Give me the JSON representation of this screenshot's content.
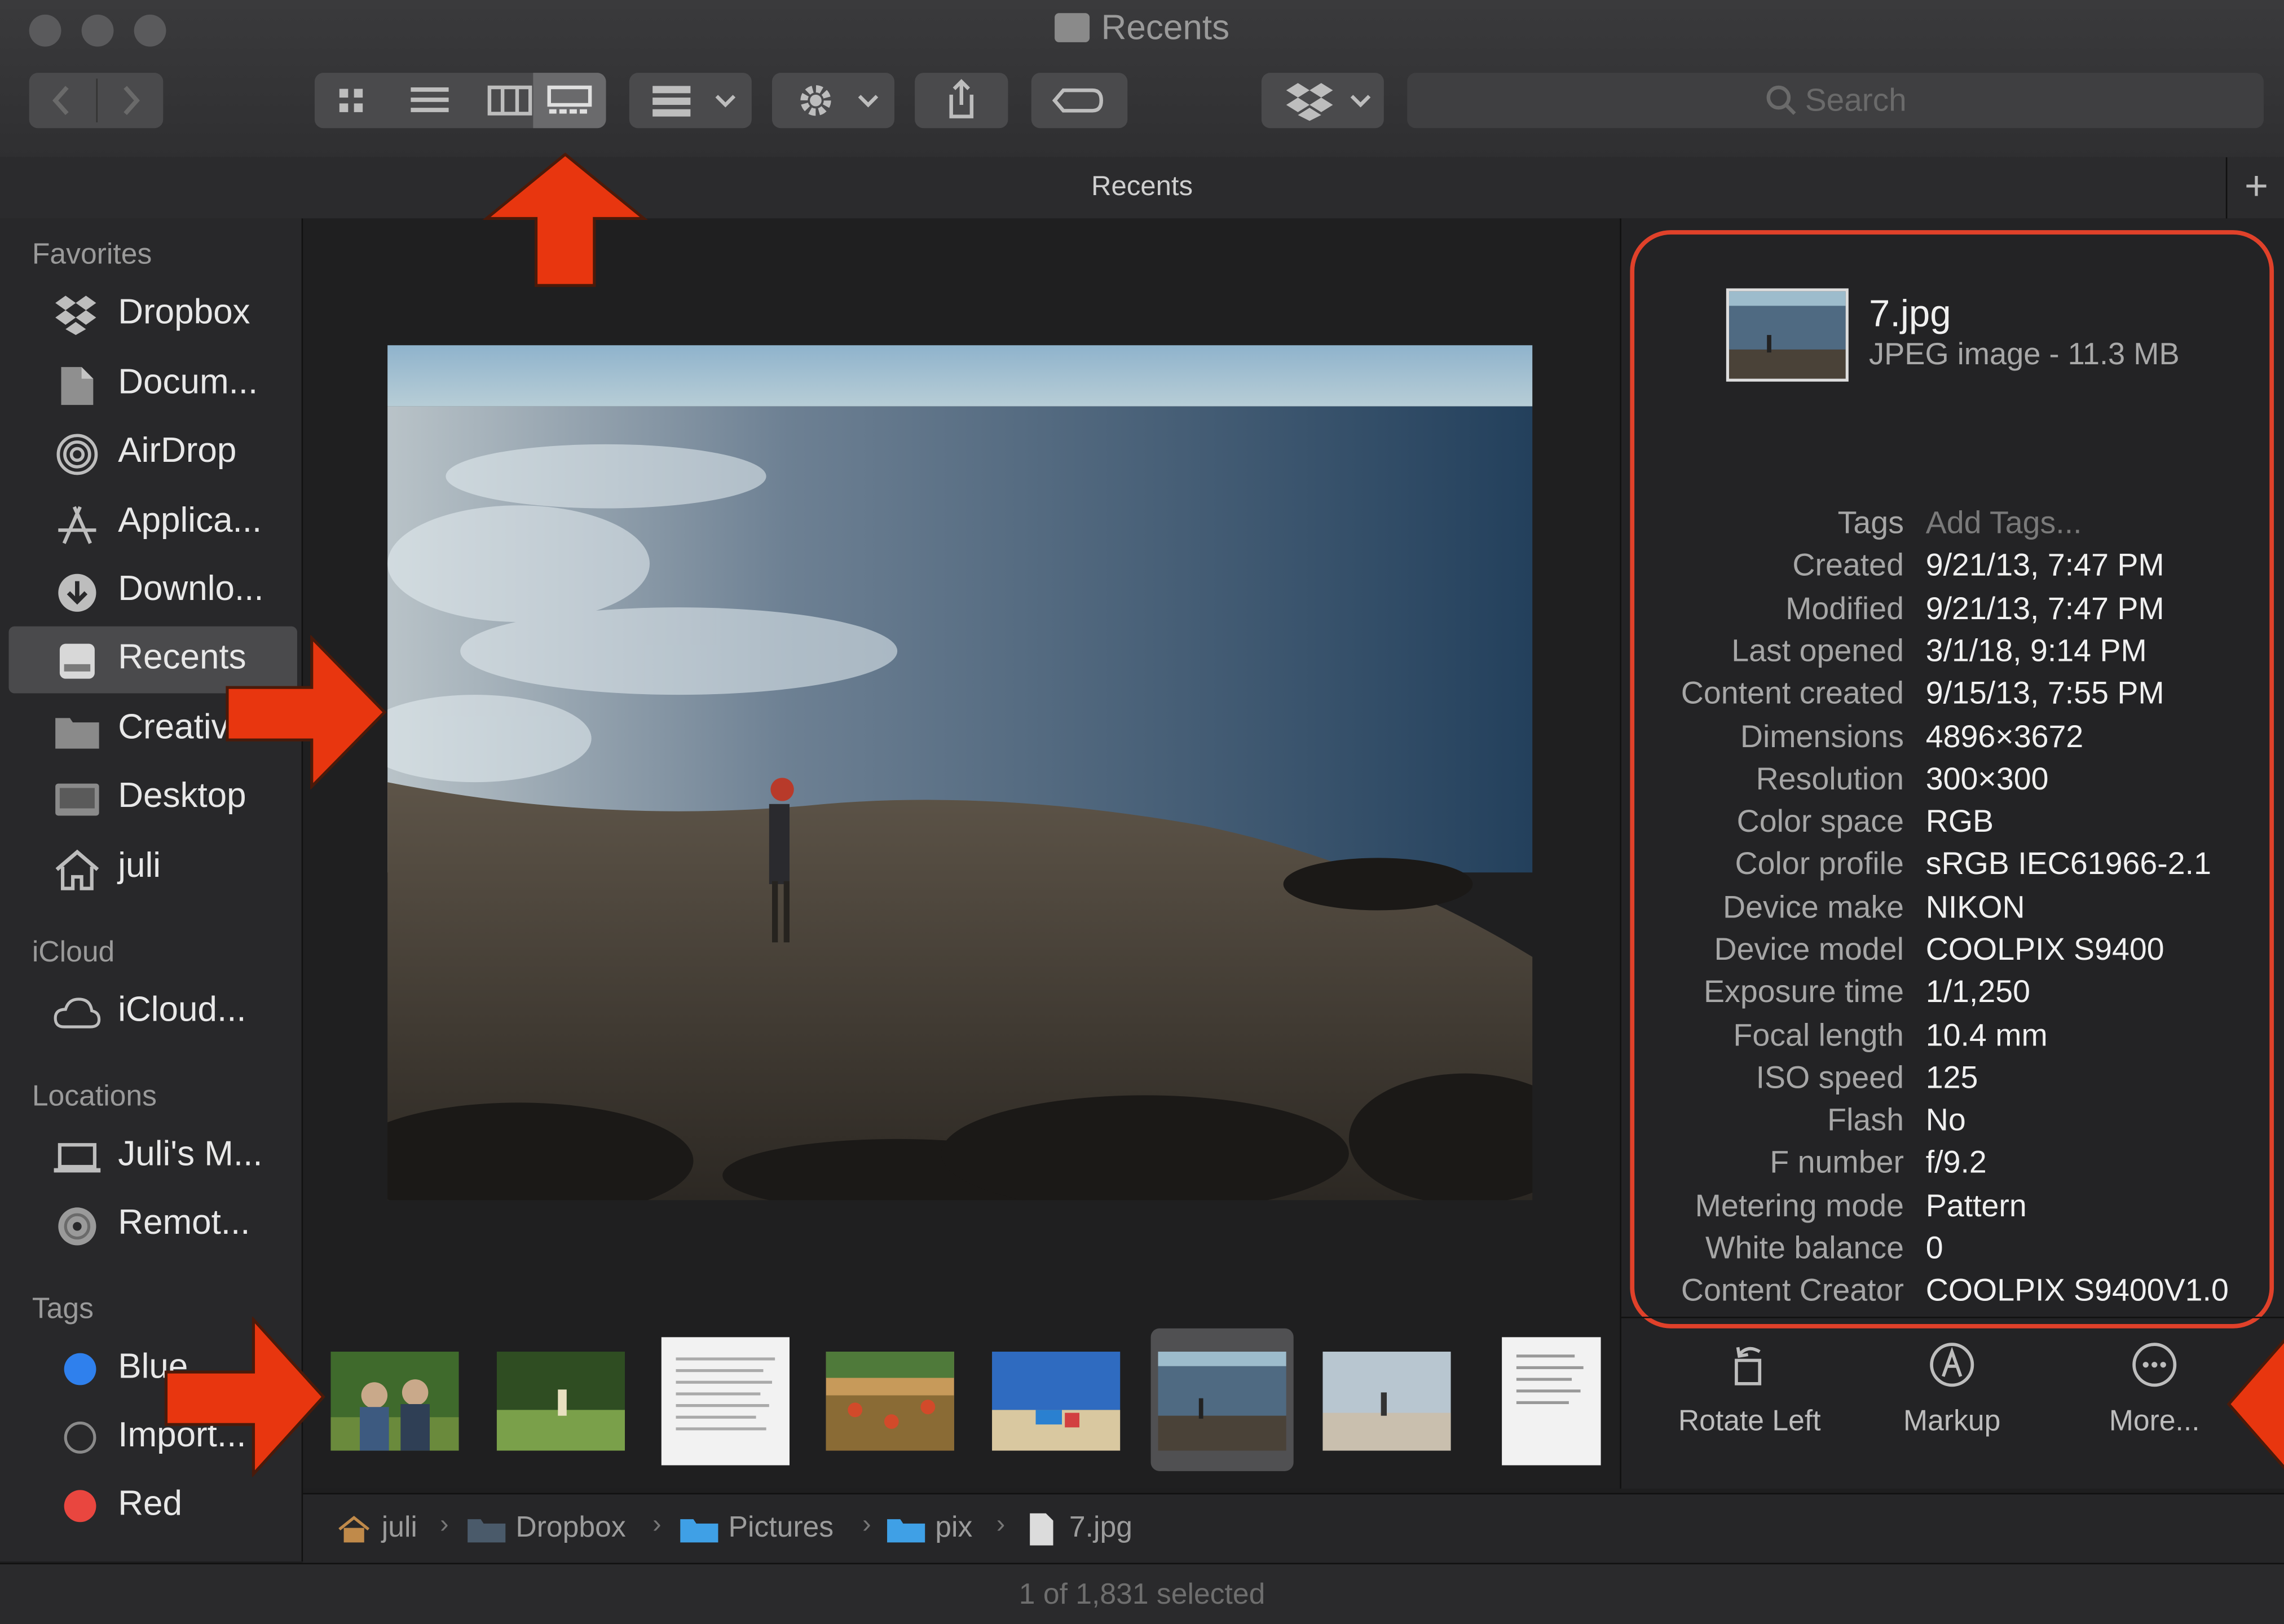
{
  "window": {
    "title": "Recents"
  },
  "tab": {
    "title": "Recents"
  },
  "search": {
    "placeholder": "Search"
  },
  "sidebar": {
    "favorites_header": "Favorites",
    "favorites": [
      {
        "label": "Dropbox",
        "icon": "dropbox-icon"
      },
      {
        "label": "Docum...",
        "icon": "documents-icon"
      },
      {
        "label": "AirDrop",
        "icon": "airdrop-icon"
      },
      {
        "label": "Applica...",
        "icon": "applications-icon"
      },
      {
        "label": "Downlo...",
        "icon": "downloads-icon"
      },
      {
        "label": "Recents",
        "icon": "recents-icon"
      },
      {
        "label": "Creativ...",
        "icon": "folder-icon"
      },
      {
        "label": "Desktop",
        "icon": "desktop-icon"
      },
      {
        "label": "juli",
        "icon": "home-icon"
      }
    ],
    "icloud_header": "iCloud",
    "icloud": [
      {
        "label": "iCloud...",
        "icon": "cloud-icon"
      }
    ],
    "locations_header": "Locations",
    "locations": [
      {
        "label": "Juli's M...",
        "icon": "laptop-icon"
      },
      {
        "label": "Remot...",
        "icon": "disc-icon"
      }
    ],
    "tags_header": "Tags",
    "tags": [
      {
        "label": "Blue",
        "color": "#2f80ed"
      },
      {
        "label": "Import...",
        "color": ""
      },
      {
        "label": "Red",
        "color": "#e9463f"
      }
    ]
  },
  "inspector": {
    "file_name": "7.jpg",
    "file_kind": "JPEG image - 11.3 MB",
    "metadata": [
      {
        "key": "Tags",
        "value": "Add Tags..."
      },
      {
        "key": "Created",
        "value": "9/21/13, 7:47 PM"
      },
      {
        "key": "Modified",
        "value": "9/21/13, 7:47 PM"
      },
      {
        "key": "Last opened",
        "value": "3/1/18, 9:14 PM"
      },
      {
        "key": "Content created",
        "value": "9/15/13, 7:55 PM"
      },
      {
        "key": "Dimensions",
        "value": "4896×3672"
      },
      {
        "key": "Resolution",
        "value": "300×300"
      },
      {
        "key": "Color space",
        "value": "RGB"
      },
      {
        "key": "Color profile",
        "value": "sRGB IEC61966-2.1"
      },
      {
        "key": "Device make",
        "value": "NIKON"
      },
      {
        "key": "Device model",
        "value": "COOLPIX S9400"
      },
      {
        "key": "Exposure time",
        "value": "1/1,250"
      },
      {
        "key": "Focal length",
        "value": "10.4 mm"
      },
      {
        "key": "ISO speed",
        "value": "125"
      },
      {
        "key": "Flash",
        "value": "No"
      },
      {
        "key": "F number",
        "value": "f/9.2"
      },
      {
        "key": "Metering mode",
        "value": "Pattern"
      },
      {
        "key": "White balance",
        "value": "0"
      },
      {
        "key": "Content Creator",
        "value": "COOLPIX S9400V1.0"
      }
    ],
    "actions": [
      {
        "label": "Rotate Left",
        "icon": "rotate-left-icon"
      },
      {
        "label": "Markup",
        "icon": "markup-icon"
      },
      {
        "label": "More...",
        "icon": "more-icon"
      }
    ]
  },
  "path": [
    {
      "label": "juli",
      "icon": "home-icon"
    },
    {
      "label": "Dropbox",
      "icon": "dropbox-folder-icon"
    },
    {
      "label": "Pictures",
      "icon": "folder-icon"
    },
    {
      "label": "pix",
      "icon": "folder-icon"
    },
    {
      "label": "7.jpg",
      "icon": "file-icon"
    }
  ],
  "status": {
    "text": "1 of 1,831 selected"
  },
  "colors": {
    "accent_red": "#e0412a",
    "arrow_red": "#e8360f"
  }
}
